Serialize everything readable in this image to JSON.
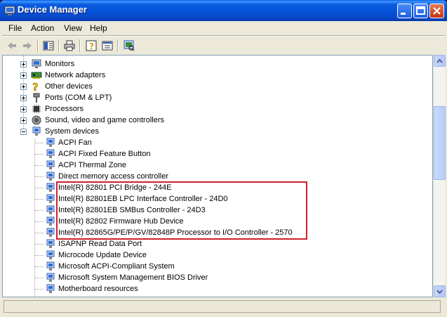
{
  "window": {
    "title": "Device Manager"
  },
  "menu": [
    "File",
    "Action",
    "View",
    "Help"
  ],
  "toolbar": {
    "icons": [
      "back-arrow-icon",
      "forward-arrow-icon",
      "show-hide-console-tree-icon",
      "print-icon",
      "help-icon",
      "properties-icon",
      "scan-hardware-icon"
    ]
  },
  "tree": {
    "categories": [
      {
        "label": "Monitors",
        "icon": "monitor-icon",
        "state": "collapsed"
      },
      {
        "label": "Network adapters",
        "icon": "network-adapter-icon",
        "state": "collapsed"
      },
      {
        "label": "Other devices",
        "icon": "unknown-device-icon",
        "state": "collapsed"
      },
      {
        "label": "Ports (COM & LPT)",
        "icon": "port-icon",
        "state": "collapsed"
      },
      {
        "label": "Processors",
        "icon": "processor-icon",
        "state": "collapsed"
      },
      {
        "label": "Sound, video and game controllers",
        "icon": "sound-icon",
        "state": "collapsed"
      },
      {
        "label": "System devices",
        "icon": "system-device-icon",
        "state": "expanded"
      }
    ],
    "system_devices": [
      "ACPI Fan",
      "ACPI Fixed Feature Button",
      "ACPI Thermal Zone",
      "Direct memory access controller",
      "Intel(R) 82801 PCI Bridge - 244E",
      "Intel(R) 82801EB LPC Interface Controller - 24D0",
      "Intel(R) 82801EB SMBus Controller - 24D3",
      "Intel(R) 82802 Firmware Hub Device",
      "Intel(R) 82865G/PE/P/GV/82848P Processor to I/O Controller - 2570",
      "ISAPNP Read Data Port",
      "Microcode Update Device",
      "Microsoft ACPI-Compliant System",
      "Microsoft System Management BIOS Driver",
      "Motherboard resources"
    ],
    "highlighted_devices": [
      4,
      5,
      6,
      7,
      8
    ]
  },
  "colors": {
    "highlight_border": "#d0202a",
    "titlebar": "#0551d6"
  }
}
